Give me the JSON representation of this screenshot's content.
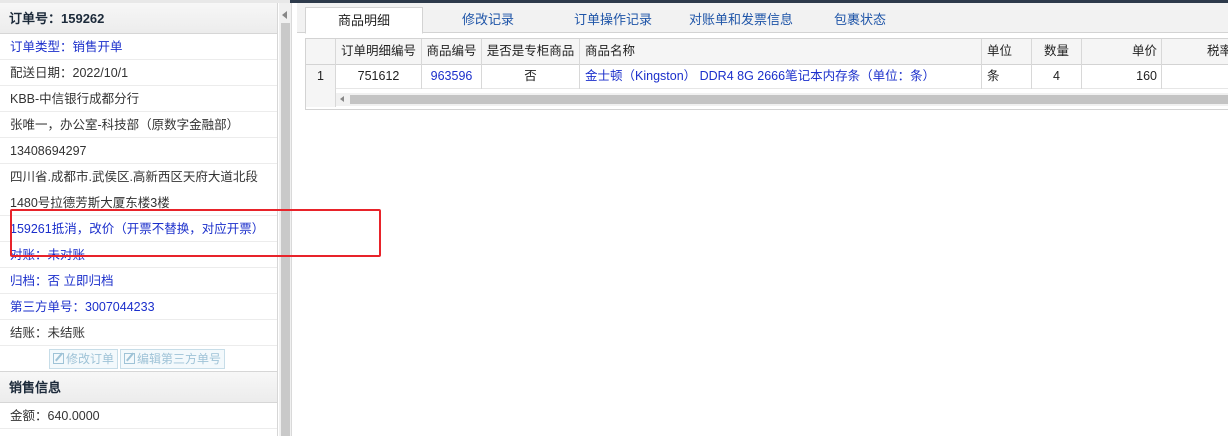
{
  "order": {
    "header": "订单号：159262",
    "type": "订单类型：销售开单",
    "delivery_date": "配送日期：2022/10/1",
    "customer": "KBB-中信银行成都分行",
    "contact": "张唯一，办公室-科技部（原数字金融部）",
    "phone": "13408694297",
    "address_line1": "四川省.成都市.武侯区.高新西区天府大道北段",
    "address_line2": "1480号拉德芳斯大厦东楼3楼",
    "remark": "159261抵消，改价（开票不替换，对应开票）",
    "reconcile": "对账：未对账",
    "archive": "归档：否 立即归档",
    "third_party_no": "第三方单号：3007044233",
    "settlement": "结账：未结账",
    "edit_order_btn": "修改订单",
    "edit_third_btn": "编辑第三方单号"
  },
  "sales": {
    "header": "销售信息",
    "amount": "金额：640.0000"
  },
  "tabs": [
    "商品明细",
    "修改记录",
    "订单操作记录",
    "对账单和发票信息",
    "包裹状态"
  ],
  "grid": {
    "columns": [
      "订单明细编号",
      "商品编号",
      "是否是专柜商品",
      "商品名称",
      "单位",
      "数量",
      "单价",
      "税率"
    ],
    "rows": [
      {
        "index": "1",
        "detail_no": "751612",
        "product_no": "963596",
        "is_counter": "否",
        "name": "金士顿（Kingston） DDR4 8G 2666笔记本内存条（单位：条）",
        "unit": "条",
        "qty": "4",
        "price": "160"
      }
    ]
  },
  "colors": {
    "link_blue": "#1b2fcb",
    "annotation_red": "#e8232a"
  }
}
